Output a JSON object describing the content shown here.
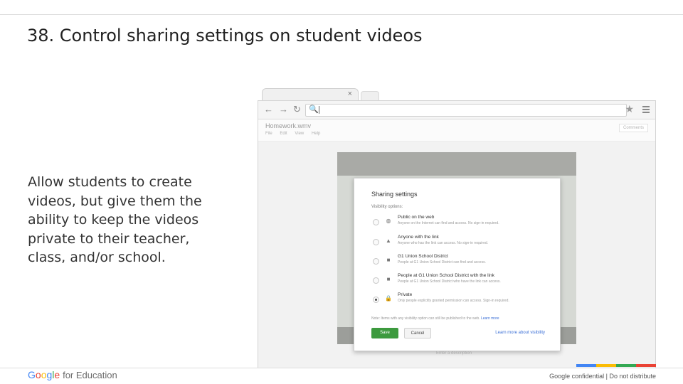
{
  "slide": {
    "title": "38. Control sharing settings on student videos",
    "body": "Allow students to create videos, but give them the ability to keep the videos private to their teacher, class, and/or school."
  },
  "browser": {
    "tab_close": "×",
    "back": "←",
    "forward": "→",
    "reload": "↻",
    "address_icon": "🔍",
    "star": "★",
    "doc_name": "Homework.wmv",
    "doc_menu": [
      "File",
      "Edit",
      "View",
      "Help"
    ],
    "doc_right_button": "Comments",
    "below_video_text": "Enter a description"
  },
  "dialog": {
    "title": "Sharing settings",
    "subtitle": "Visibility options:",
    "options": [
      {
        "label": "Public on the web",
        "desc": "Anyone on the Internet can find and access. No sign-in required.",
        "icon": "globe-icon",
        "glyph": "◍",
        "selected": false
      },
      {
        "label": "Anyone with the link",
        "desc": "Anyone who has the link can access. No sign-in required.",
        "icon": "person-icon",
        "glyph": "▲",
        "selected": false
      },
      {
        "label": "G1 Union School District",
        "desc": "People at G1 Union School District can find and access.",
        "icon": "building-icon",
        "glyph": "■",
        "selected": false
      },
      {
        "label": "People at G1 Union School District with the link",
        "desc": "People at G1 Union School District who have the link can access.",
        "icon": "building-link-icon",
        "glyph": "■",
        "selected": false
      },
      {
        "label": "Private",
        "desc": "Only people explicitly granted permission can access. Sign-in required.",
        "icon": "lock-icon",
        "glyph": "🔒",
        "selected": true
      }
    ],
    "note": "Note: Items with any visibility option can still be published to the web.",
    "note_link": "Learn more",
    "save_label": "Save",
    "cancel_label": "Cancel",
    "learn_more_label": "Learn more about visibility"
  },
  "footer": {
    "logo_google": "Google",
    "logo_suffix": "for Education",
    "confidential": "Google confidential | Do not distribute"
  },
  "colors": {
    "brand": [
      "#4285f4",
      "#fbbc05",
      "#34a853",
      "#ea4335"
    ],
    "google_letters": [
      "#4285f4",
      "#ea4335",
      "#fbbc05",
      "#4285f4",
      "#34a853",
      "#ea4335"
    ],
    "save_button": "#3c9a3e",
    "link": "#3b6fd6"
  }
}
